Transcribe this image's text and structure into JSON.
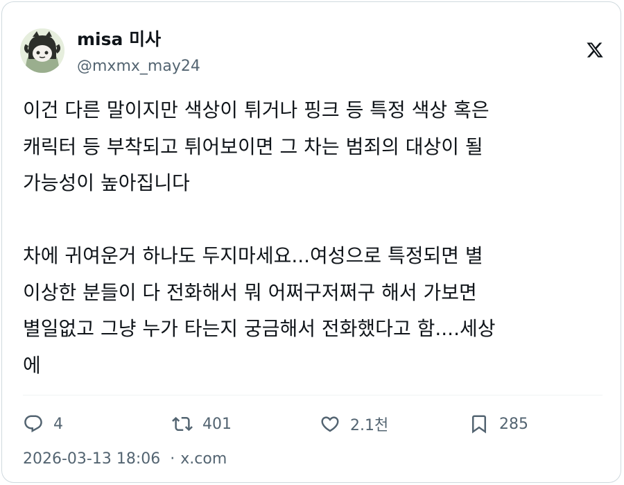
{
  "author": {
    "display_name": "misa 미사",
    "handle": "@mxmx_may24",
    "avatar_icon": "avatar-cartoon-icon"
  },
  "brand_icon": "x-logo-icon",
  "tweet": {
    "paragraph1": [
      "이건 다른 말이지만 색상이 튀거나 핑크 등 특정 색상 혹은",
      "캐릭터 등 부착되고 튀어보이면 그 차는 범죄의 대상이 될",
      "가능성이 높아집니다"
    ],
    "paragraph2": [
      "차에 귀여운거 하나도 두지마세요...여성으로 특정되면 별",
      "이상한 분들이 다 전화해서 뭐 어쩌구저쩌구 해서 가보면",
      "별일없고 그냥 누가 타는지 궁금해서 전화했다고 함....세상",
      "에"
    ]
  },
  "actions": {
    "replies": {
      "icon": "reply-icon",
      "count": "4"
    },
    "reposts": {
      "icon": "repost-icon",
      "count": "401"
    },
    "likes": {
      "icon": "heart-icon",
      "count": "2.1천"
    },
    "bookmarks": {
      "icon": "bookmark-icon",
      "count": "285"
    }
  },
  "meta": {
    "timestamp": "2026-03-13 18:06",
    "separator": "·",
    "source": "x.com"
  },
  "colors": {
    "text": "#0f1419",
    "secondary": "#536471",
    "border": "#cfd9de"
  }
}
